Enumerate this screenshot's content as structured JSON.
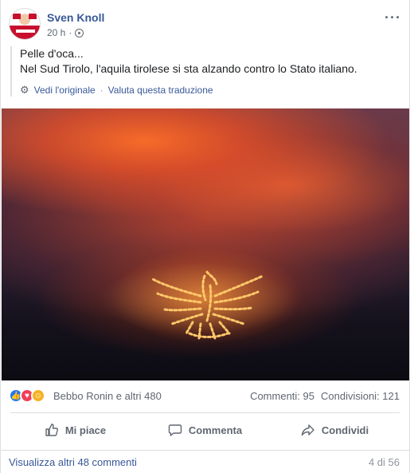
{
  "post": {
    "author": "Sven Knoll",
    "time": "20 h",
    "time_separator": "·",
    "more_icon": "ellipsis-icon",
    "text_lines": [
      "Pelle d'oca...",
      "Nel Sud Tirolo, l'aquila tirolese si sta alzando contro lo Stato italiano."
    ],
    "see_original": "Vedi l'originale",
    "rate_translation": "Valuta questa traduzione",
    "separator": "·"
  },
  "reactions": {
    "names": "Bebbo Ronin e altri 480",
    "comments": "Commenti: 95",
    "shares": "Condivisioni: 121"
  },
  "actions": {
    "like": "Mi piace",
    "comment": "Commenta",
    "share": "Condividi"
  },
  "footer": {
    "more_comments": "Visualizza altri 48 commenti",
    "paging": "4 di 56"
  },
  "colors": {
    "link": "#385898",
    "like": "#2078f4",
    "love": "#f33e58",
    "haha": "#f7b125",
    "fire": "#ffb347"
  }
}
